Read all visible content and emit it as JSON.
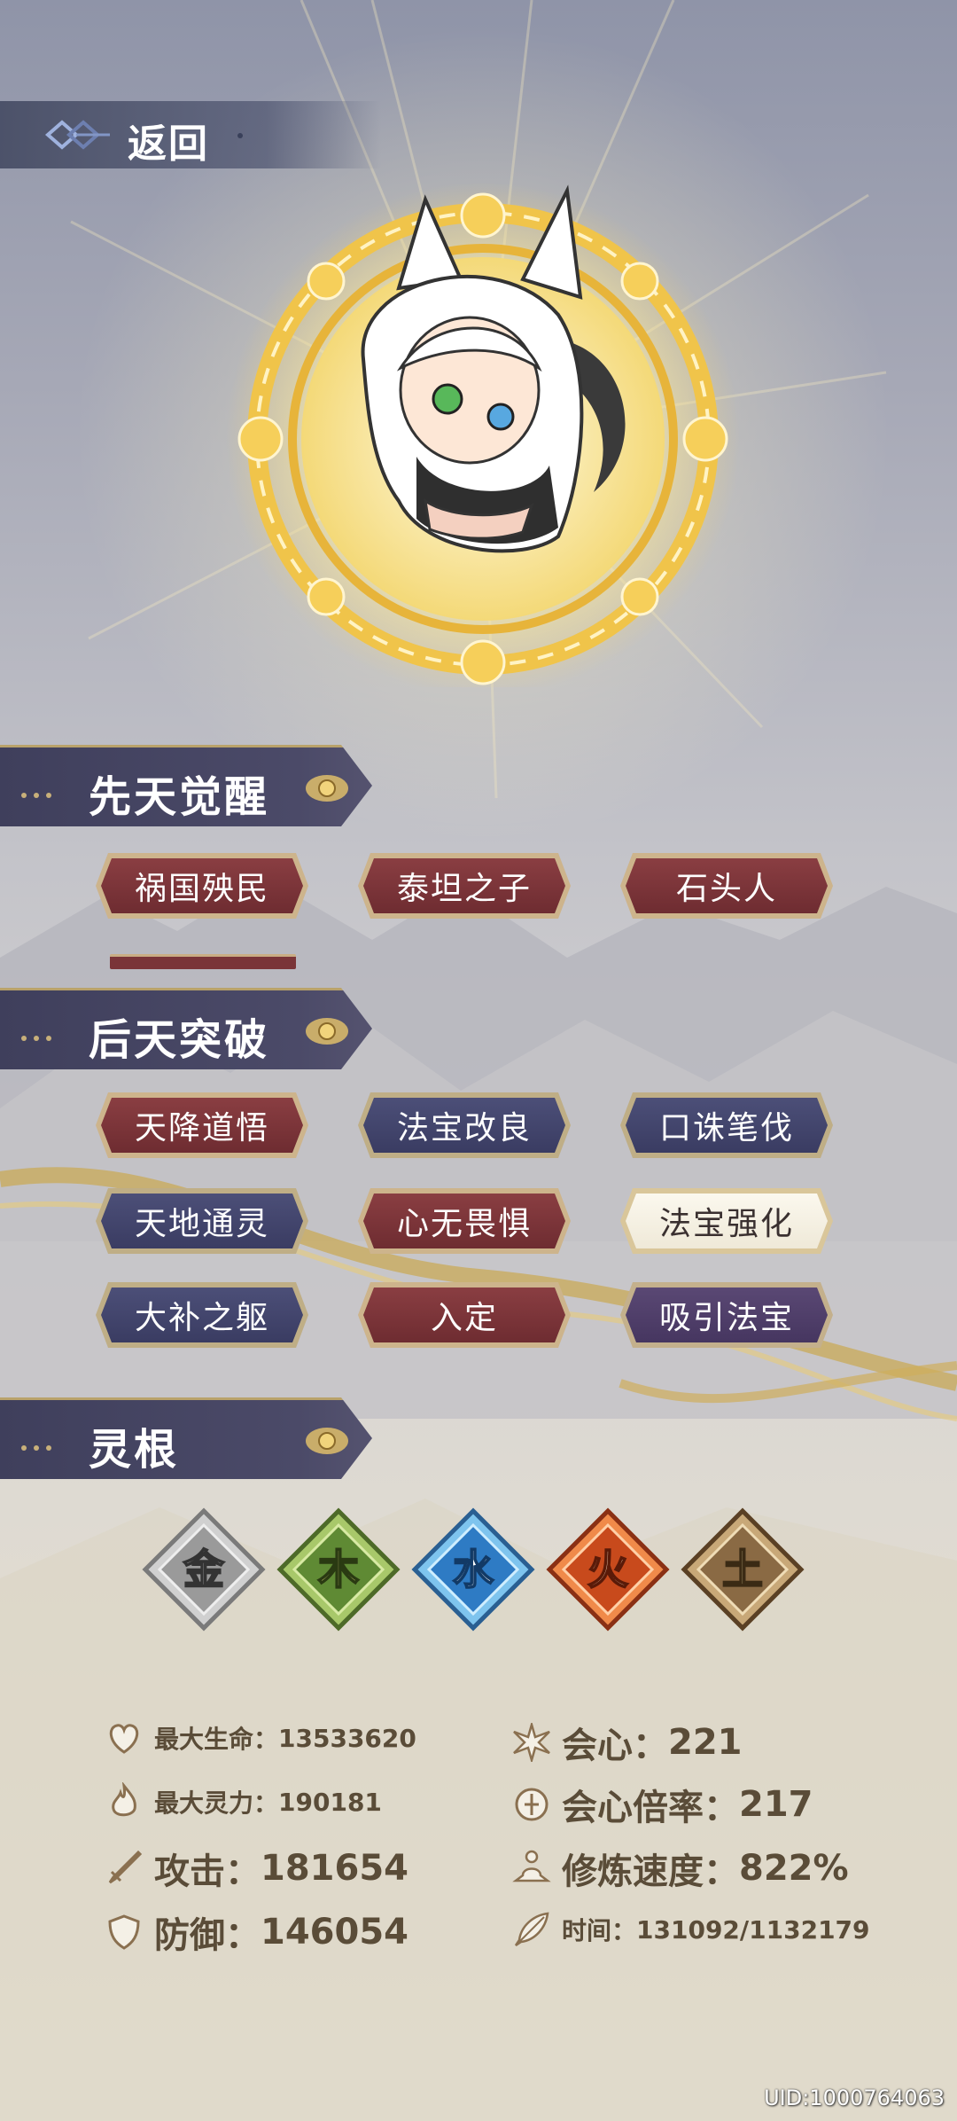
{
  "nav": {
    "back_label": "返回"
  },
  "sections": {
    "innate": "先天觉醒",
    "acquired": "后天突破",
    "root": "灵根"
  },
  "innate_tags": [
    "祸国殃民",
    "泰坦之子",
    "石头人"
  ],
  "acquired_tags": [
    "天降道悟",
    "法宝改良",
    "口诛笔伐",
    "天地通灵",
    "心无畏惧",
    "法宝强化",
    "大补之躯",
    "入定",
    "吸引法宝"
  ],
  "elements": [
    "金",
    "木",
    "水",
    "火",
    "土"
  ],
  "stats": {
    "max_hp": {
      "label": "最大生命：",
      "value": "13533620"
    },
    "max_spirit": {
      "label": "最大灵力：",
      "value": "190181"
    },
    "attack": {
      "label": "攻击：",
      "value": "181654"
    },
    "defense": {
      "label": "防御：",
      "value": "146054"
    },
    "crit": {
      "label": "会心：",
      "value": "221"
    },
    "crit_rate": {
      "label": "会心倍率：",
      "value": "217"
    },
    "cultivation_speed": {
      "label": "修炼速度：",
      "value": "822%"
    },
    "time": {
      "label": "时间：",
      "value": "131092/1132179"
    }
  },
  "uid": "UID:1000764063",
  "colors": {
    "tag_red": "#7a3438",
    "tag_navy": "#42456c",
    "tag_purple": "#503e6a",
    "tag_selected": "#f6f2e4",
    "gold": "#e8b43a",
    "header_bg": "#46455f"
  }
}
